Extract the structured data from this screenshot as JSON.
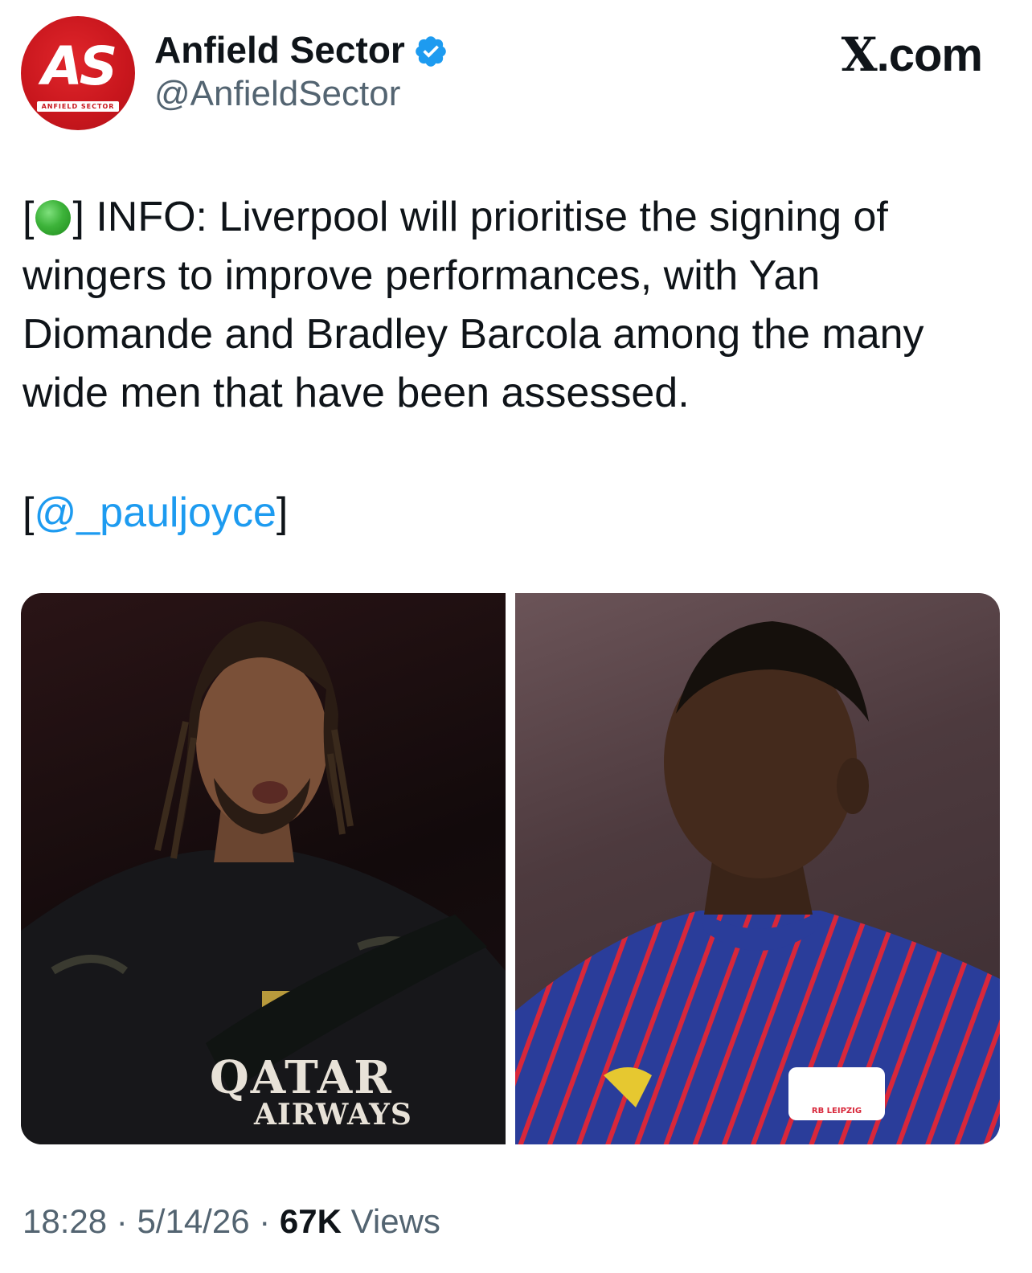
{
  "header": {
    "display_name": "Anfield Sector",
    "handle": "@AnfieldSector",
    "avatar_monogram": "AS",
    "avatar_subtext": "ANFIELD SECTOR",
    "brand": "X.com",
    "brand_x": "X",
    "brand_rest": ".com",
    "verified_color": "#1d9bf0"
  },
  "tweet": {
    "open_bracket": "[",
    "close_bracket_text": "] INFO: Liverpool will prioritise the signing of wingers to improve performances, with Yan Diomande and Bradley Barcola among the many wide men that have been assessed.",
    "source_open": "[",
    "source_mention": "@_pauljoyce",
    "source_close": "]",
    "status_icon": "green-circle"
  },
  "media": {
    "left_sponsor_line1": "QATAR",
    "left_sponsor_line2": "AIRWAYS",
    "right_badge_text": "RB LEIPZIG"
  },
  "footer": {
    "time": "18:28",
    "separator": " · ",
    "date": "5/14/26",
    "views_count": "67K",
    "views_label": " Views"
  },
  "colors": {
    "link": "#1d9bf0",
    "secondary_text": "#536471",
    "primary_text": "#0f1419",
    "avatar_red": "#c8161d"
  }
}
